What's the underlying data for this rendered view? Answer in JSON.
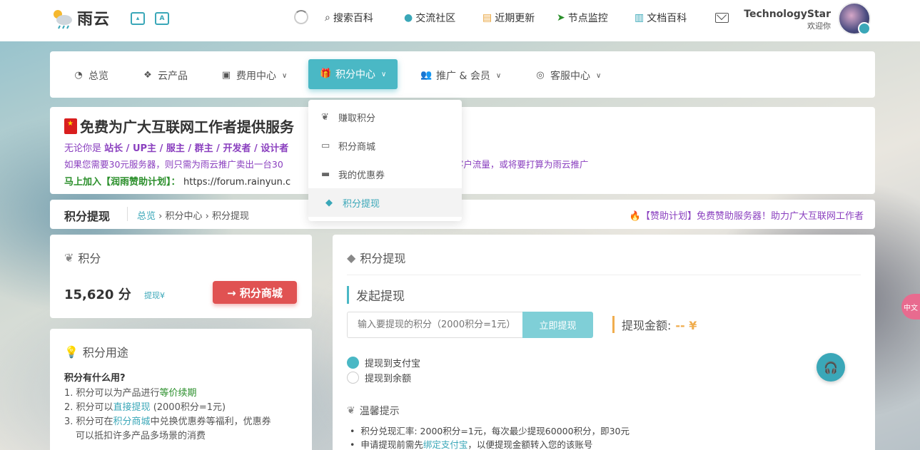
{
  "topbar": {
    "logo_text": "雨云",
    "icon_image_label": "",
    "icon_translate_label": "A",
    "nav": [
      {
        "icon": "search-icon",
        "glyph": "⌕",
        "label": "搜索百科"
      },
      {
        "icon": "community-icon",
        "glyph": "●",
        "label": "交流社区"
      },
      {
        "icon": "update-icon",
        "glyph": "▤",
        "label": "近期更新"
      },
      {
        "icon": "monitor-icon",
        "glyph": "➤",
        "label": "节点监控"
      },
      {
        "icon": "docs-icon",
        "glyph": "▥",
        "label": "文档百科"
      }
    ],
    "user": {
      "name": "TechnologyStar",
      "welcome": "欢迎你"
    }
  },
  "menubar": [
    {
      "icon": "dashboard-icon",
      "glyph": "◔",
      "label": "总览",
      "chevron": ""
    },
    {
      "icon": "cubes-icon",
      "glyph": "❖",
      "label": "云产品",
      "chevron": ""
    },
    {
      "icon": "money-icon",
      "glyph": "▣",
      "label": "费用中心",
      "chevron": "∨"
    },
    {
      "icon": "gift-icon",
      "glyph": "🎁",
      "label": "积分中心",
      "chevron": "∨"
    },
    {
      "icon": "users-icon",
      "glyph": "👥",
      "label": "推广 & 会员",
      "chevron": "∨"
    },
    {
      "icon": "headset-icon",
      "glyph": "◎",
      "label": "客服中心",
      "chevron": "∨"
    }
  ],
  "dropdown": [
    {
      "icon": "earn-icon",
      "glyph": "❦",
      "label": "赚取积分"
    },
    {
      "icon": "store-icon",
      "glyph": "▭",
      "label": "积分商城"
    },
    {
      "icon": "coupon-icon",
      "glyph": "▬",
      "label": "我的优惠券"
    },
    {
      "icon": "diamond-icon",
      "glyph": "◆",
      "label": "积分提现"
    }
  ],
  "banner": {
    "title": "免费为广大互联网工作者提供服务",
    "line2_prefix": "无论你是",
    "line2_roles": "站长 / UP主 / 服主 / 群主 / 开发者 / 设计者",
    "line3_left": "如果您需要30元服务器，则只需为雨云推广卖出一台30",
    "line3_right": "只要您有客户流量，或将要打算为雨云推广",
    "line4_label": "马上加入【润雨赞助计划】：",
    "line4_url": "https://forum.rainyun.c"
  },
  "crumbbar": {
    "title": "积分提现",
    "crumbs": [
      "总览",
      "积分中心",
      "积分提现"
    ],
    "promo": "【赞助计划】免费赞助服务器！助力广大互联网工作者"
  },
  "points": {
    "title": "积分",
    "value": "15,620 分",
    "withdraw_link": "提现¥",
    "shop_button": "→ 积分商城"
  },
  "usage": {
    "title": "积分用途",
    "question": "积分有什么用?",
    "items": [
      {
        "pre": "1. 积分可以为产品进行",
        "hl": "等价续期",
        "post": ""
      },
      {
        "pre": "2. 积分可以",
        "hl": "直接提现",
        "post": " (2000积分=1元)"
      },
      {
        "pre": "3. 积分可在",
        "hl": "积分商城",
        "post": "中兑换优惠券等福利，优惠券"
      },
      {
        "pre": "   可以抵扣许多产品多场景的消费",
        "hl": "",
        "post": ""
      }
    ]
  },
  "withdraw": {
    "title": "积分提现",
    "section": "发起提现",
    "input_placeholder": "输入要提现的积分（2000积分=1元）",
    "submit": "立即提现",
    "amount_label": "提现金额:",
    "amount_value": "-- ¥",
    "options": [
      "提现到支付宝",
      "提现到余额"
    ],
    "tips_title": "温馨提示",
    "tips": [
      {
        "pre": "积分兑现汇率: 2000积分=1元，每次最少提现60000积分，即30元",
        "hl": "",
        "post": ""
      },
      {
        "pre": "申请提现前需先",
        "hl": "绑定支付宝",
        "post": "，以便提现金额转入您的该账号"
      }
    ]
  },
  "floating": {
    "edge_label": "中文"
  }
}
